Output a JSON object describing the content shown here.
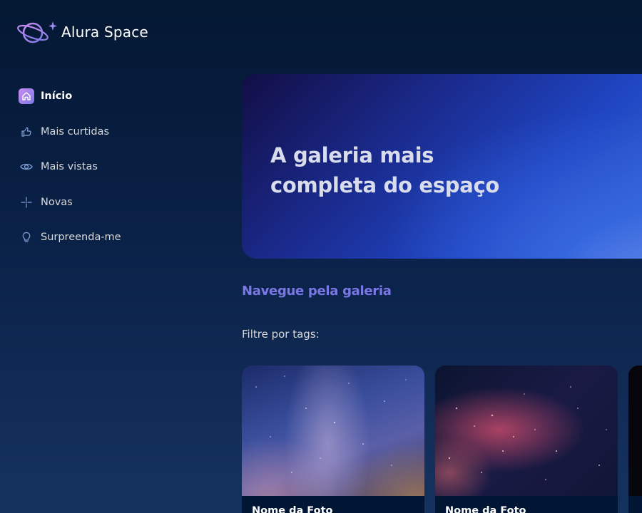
{
  "app": {
    "name": "Alura Space"
  },
  "sidebar": {
    "items": [
      {
        "label": "Início",
        "icon": "home-icon",
        "active": true
      },
      {
        "label": "Mais curtidas",
        "icon": "thumbs-up-icon",
        "active": false
      },
      {
        "label": "Mais vistas",
        "icon": "eye-icon",
        "active": false
      },
      {
        "label": "Novas",
        "icon": "sparkle-icon",
        "active": false
      },
      {
        "label": "Surpreenda-me",
        "icon": "lightbulb-icon",
        "active": false
      }
    ]
  },
  "banner": {
    "title": "A galeria mais completa do espaço"
  },
  "gallery": {
    "title": "Navegue pela galeria",
    "filter_label": "Filtre por tags:",
    "cards": [
      {
        "name": "Nome da Foto"
      },
      {
        "name": "Nome da Foto"
      },
      {
        "name": ""
      }
    ]
  },
  "colors": {
    "accent": "#7b78e5",
    "active_icon_gradient_start": "#c98cf1",
    "background_top": "#041833",
    "card_footer": "#001634"
  }
}
